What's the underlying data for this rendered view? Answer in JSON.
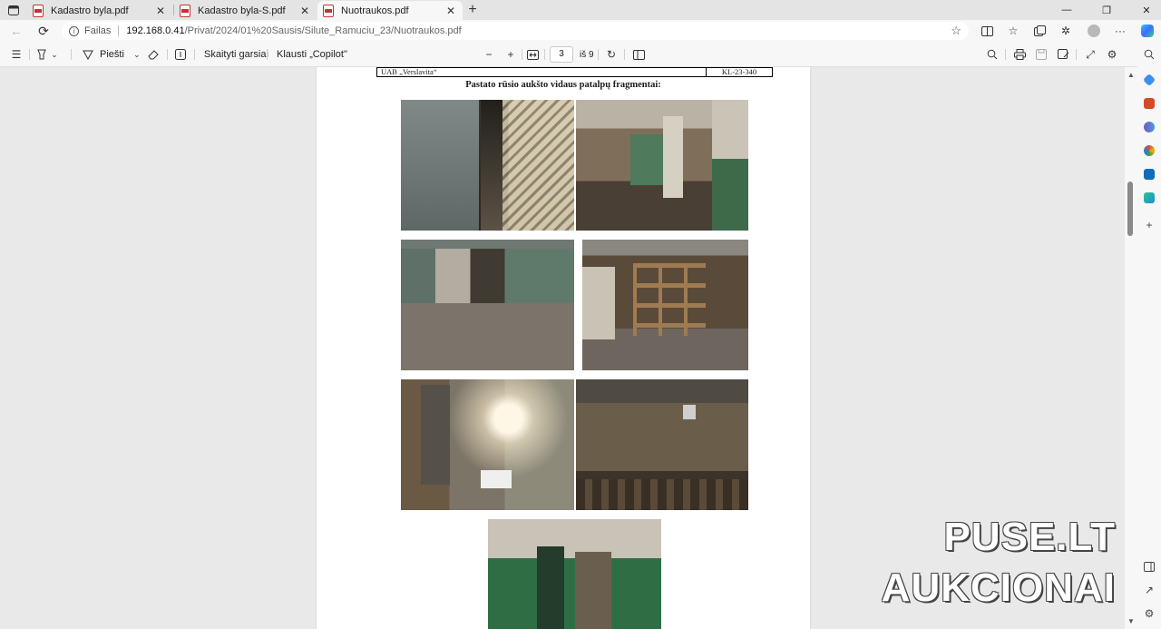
{
  "browser": {
    "tabs": [
      {
        "label": "Kadastro byla.pdf",
        "close": "✕"
      },
      {
        "label": "Kadastro byla-S.pdf",
        "close": "✕"
      },
      {
        "label": "Nuotraukos.pdf",
        "close": "✕"
      }
    ],
    "new_tab": "+",
    "window_controls": {
      "minimize": "—",
      "restore": "❐",
      "close": "✕"
    },
    "address": {
      "scheme_label": "Failas",
      "host": "192.168.0.41",
      "path": "/Privat/2024/01%20Sausis/Silute_Ramuciu_23/Nuotraukos.pdf"
    }
  },
  "pdf_toolbar": {
    "draw_label": "Piešti",
    "read_aloud_label": "Skaityti garsiai",
    "ask_copilot_label": "Klausti „Copilot\"",
    "zoom_out": "−",
    "zoom_in": "+",
    "current_page": "3",
    "page_count_label": "iš 9"
  },
  "document": {
    "header_left": "UAB „Verslavita“",
    "header_right": "KL-23-340",
    "heading": "Pastato rūsio aukšto vidaus patalpų fragmentai:"
  },
  "watermark": {
    "line1": "PUSE.LT",
    "line2": "AUKCIONAI"
  },
  "colors": {
    "accent": "#0f6cbd",
    "chrome_bg": "#f7f7f7",
    "tabstrip_bg": "#e4e4e4",
    "viewer_bg": "#e9e9e9",
    "pdf_red": "#c23434"
  },
  "icons": {
    "tab_actions": "tab-actions-icon",
    "back": "back-arrow-icon",
    "refresh": "refresh-icon",
    "favorite": "star-icon",
    "split": "split-screen-icon",
    "favorites": "favorites-icon",
    "collections": "collections-icon",
    "extensions": "extensions-icon",
    "copilot": "copilot-icon"
  }
}
